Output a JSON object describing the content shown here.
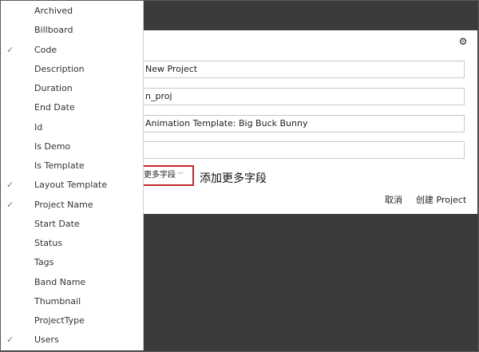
{
  "dialog": {
    "fields": [
      {
        "value": "New Project"
      },
      {
        "value": "n_proj"
      },
      {
        "value": "Animation Template: Big Buck Bunny"
      },
      {
        "value": ""
      }
    ],
    "more_fields_label": "更多字段",
    "more_fields_hint": "添加更多字段",
    "cancel_label": "取消",
    "create_label": "创建 Project"
  },
  "menu": {
    "items": [
      {
        "label": "Archived",
        "checked": false
      },
      {
        "label": "Billboard",
        "checked": false
      },
      {
        "label": "Code",
        "checked": true
      },
      {
        "label": "Description",
        "checked": false
      },
      {
        "label": "Duration",
        "checked": false
      },
      {
        "label": "End Date",
        "checked": false
      },
      {
        "label": "Id",
        "checked": false
      },
      {
        "label": "Is Demo",
        "checked": false
      },
      {
        "label": "Is Template",
        "checked": false
      },
      {
        "label": "Layout Template",
        "checked": true
      },
      {
        "label": "Project Name",
        "checked": true
      },
      {
        "label": "Start Date",
        "checked": false
      },
      {
        "label": "Status",
        "checked": false
      },
      {
        "label": "Tags",
        "checked": false
      },
      {
        "label": "Band Name",
        "checked": false
      },
      {
        "label": "Thumbnail",
        "checked": false
      },
      {
        "label": "ProjectType",
        "checked": false
      },
      {
        "label": "Users",
        "checked": true
      }
    ]
  },
  "icons": {
    "settings": "gear-icon",
    "check": "check-icon",
    "dropdown": "chevron-down-icon"
  },
  "colors": {
    "backdrop": "#3b3b3b",
    "highlight_border": "#c62828"
  }
}
